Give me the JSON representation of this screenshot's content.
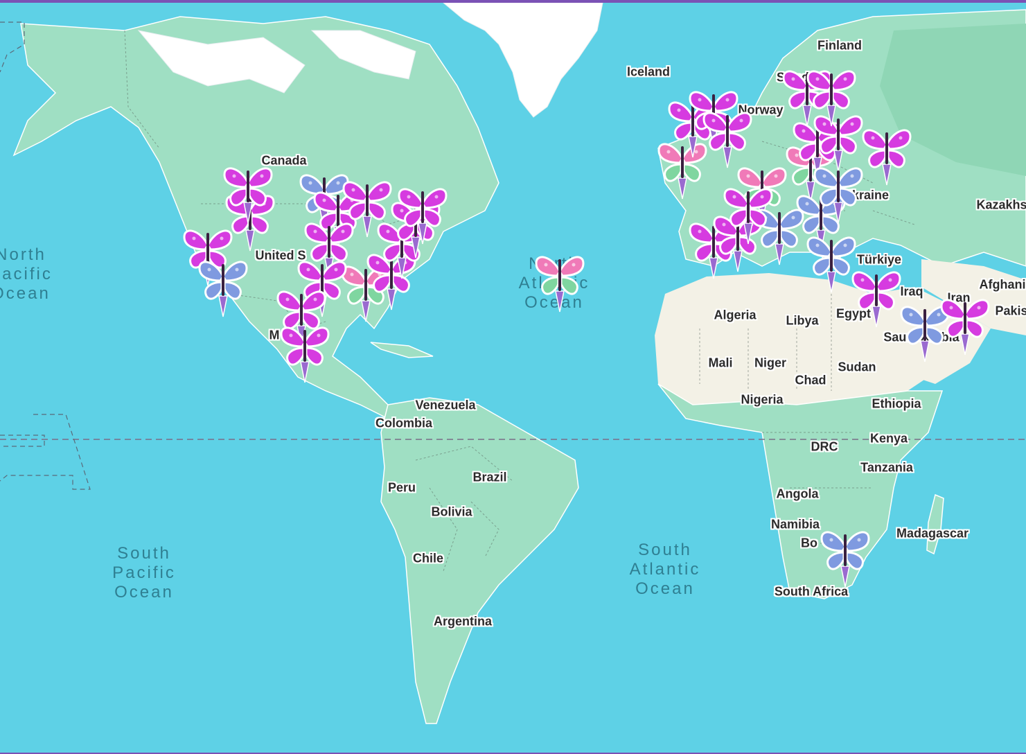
{
  "map": {
    "countries": [
      "Finland",
      "Iceland",
      "Sweden",
      "Norway",
      "Canada",
      "Ukraine",
      "Kazakhs",
      "United S",
      "Türkiye",
      "Iraq",
      "Iran",
      "Afghani",
      "Pakis",
      "Algeria",
      "Libya",
      "Egypt",
      "Saudi Arabia",
      "M",
      "Mali",
      "Niger",
      "Chad",
      "Sudan",
      "Nigeria",
      "Ethiopia",
      "Venezuela",
      "Colombia",
      "Kenya",
      "DRC",
      "Tanzania",
      "Brazil",
      "Peru",
      "Bolivia",
      "Angola",
      "Namibia",
      "Bo",
      "Madagascar",
      "Chile",
      "South Africa",
      "Argentina"
    ],
    "oceans": [
      "North\nPacific\nOcean",
      "North\nAtlantic\nOcean",
      "South\nPacific\nOcean",
      "South\nAtlantic\nOcean"
    ],
    "colors": {
      "water": "#5ed1e6",
      "land": "#9fdfc3",
      "ice": "#ffffff",
      "desert": "#f3f1e6",
      "frame": "#7b52b5",
      "marker_pink": "#d63be0",
      "marker_blue": "#7f9ae0",
      "marker_rainbow": "#f07ab8"
    },
    "marker_icon": "butterfly-pin-icon",
    "markers": [
      {
        "style": "pink"
      },
      {
        "style": "pink"
      },
      {
        "style": "blue"
      },
      {
        "style": "pink"
      },
      {
        "style": "blue"
      },
      {
        "style": "pink"
      },
      {
        "style": "pink"
      },
      {
        "style": "pink"
      },
      {
        "style": "rainbow"
      },
      {
        "style": "pink"
      },
      {
        "style": "pink"
      },
      {
        "style": "pink"
      },
      {
        "style": "pink"
      },
      {
        "style": "pink"
      },
      {
        "style": "pink"
      },
      {
        "style": "pink"
      },
      {
        "style": "rainbow"
      },
      {
        "style": "rainbow"
      },
      {
        "style": "pink"
      },
      {
        "style": "pink"
      },
      {
        "style": "pink"
      },
      {
        "style": "rainbow"
      },
      {
        "style": "rainbow"
      },
      {
        "style": "pink"
      },
      {
        "style": "pink"
      },
      {
        "style": "pink"
      },
      {
        "style": "pink"
      },
      {
        "style": "blue"
      },
      {
        "style": "pink"
      },
      {
        "style": "pink"
      },
      {
        "style": "blue"
      },
      {
        "style": "pink"
      },
      {
        "style": "blue"
      },
      {
        "style": "blue"
      },
      {
        "style": "pink"
      },
      {
        "style": "pink"
      },
      {
        "style": "blue"
      },
      {
        "style": "pink"
      },
      {
        "style": "blue"
      }
    ]
  }
}
